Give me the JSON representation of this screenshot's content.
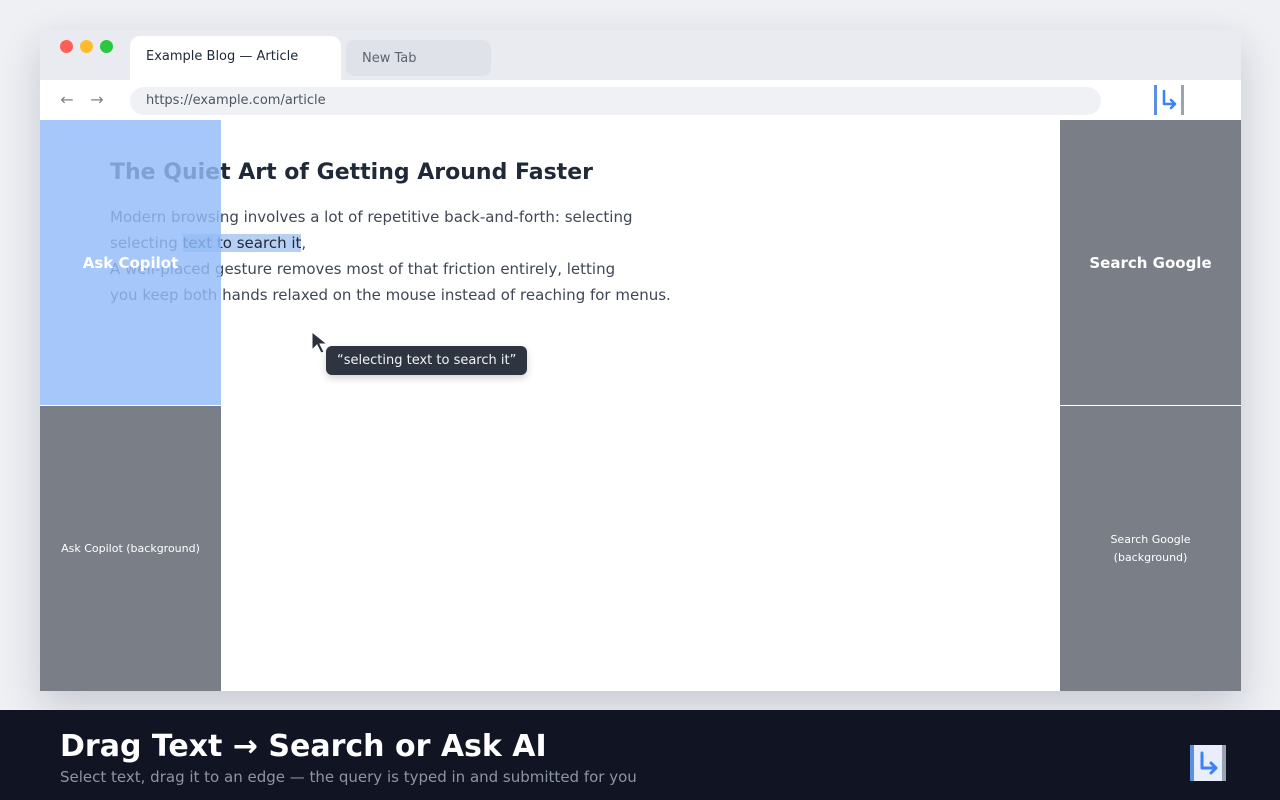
{
  "browser": {
    "tabs": [
      {
        "label": "Example Blog — Article",
        "active": true
      },
      {
        "label": "New Tab",
        "active": false
      }
    ],
    "nav": {
      "back_icon": "←",
      "forward_icon": "→"
    },
    "url": "https://example.com/article",
    "extension_icon": "drag-text-extension-icon"
  },
  "article": {
    "title": "The Quiet Art of Getting Around Faster",
    "line1": "Modern browsing involves a lot of repetitive back-and-forth: selecting",
    "line2_before": "selecting ",
    "line2_selected": "text to search it",
    "line2_after": ",",
    "line3": "A well-placed gesture removes most of that friction entirely, letting",
    "line4": "you keep both hands relaxed on the mouse instead of reaching for menus."
  },
  "drag": {
    "preview_text": "“selecting text to search it”",
    "cursor_icon": "pointer-arrow-icon"
  },
  "zones": {
    "left_top": "Ask Copilot",
    "left_bottom": "Ask Copilot (background)",
    "right_top": "Search Google",
    "right_bottom": "Search Google (background)"
  },
  "caption": {
    "title": "Drag Text → Search or Ask AI",
    "subtitle": "Select text, drag it to an edge — the query is typed in and submitted for you"
  },
  "colors": {
    "selection": "#b6cff3",
    "active_zone": "#93bbf8",
    "inactive_zone": "#7a7e87",
    "caption_bg": "#111523",
    "accent_blue": "#3b82f6"
  }
}
